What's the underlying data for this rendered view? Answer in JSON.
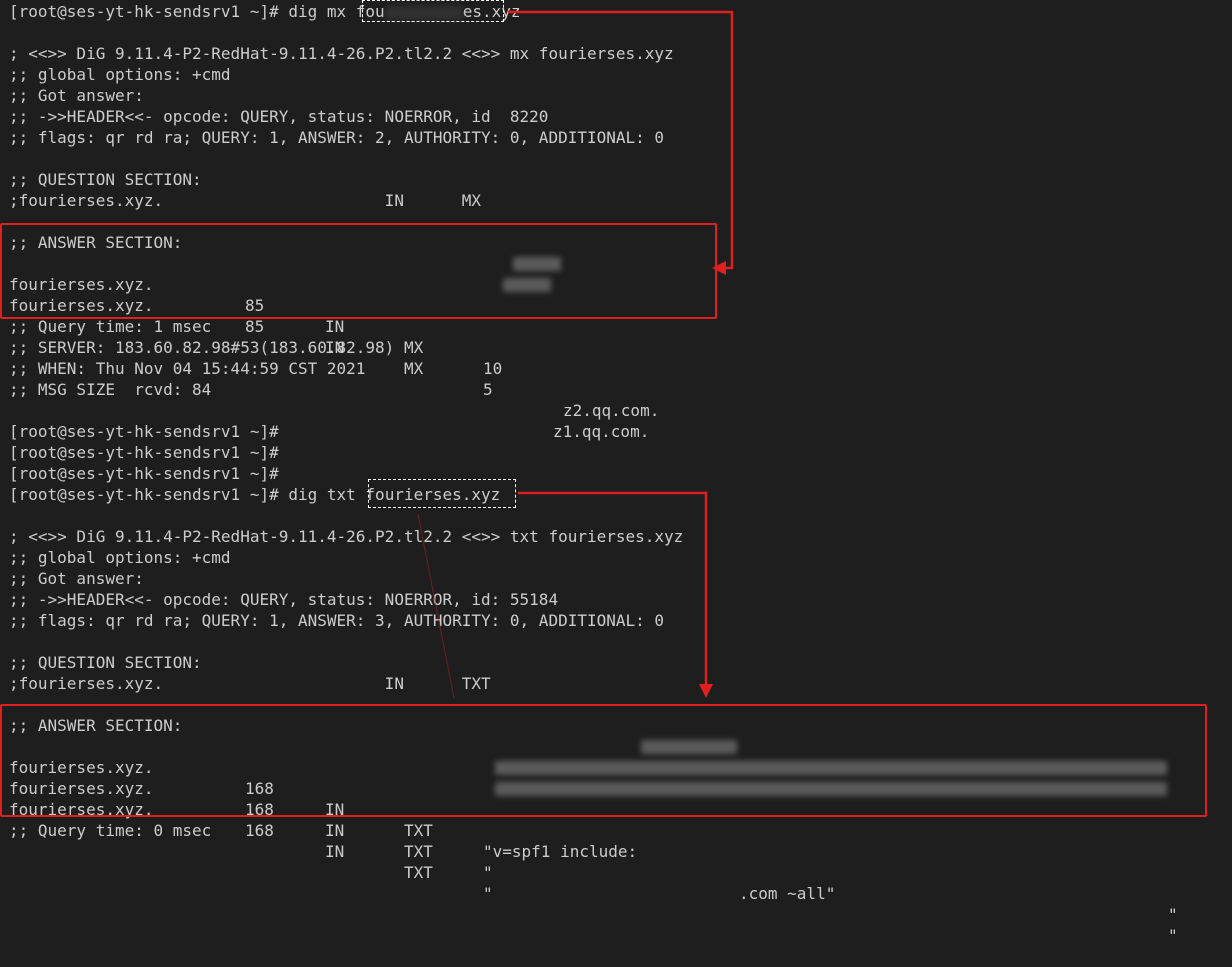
{
  "terminal": {
    "block1": {
      "prompt_cmd": "[root@ses-yt-hk-sendsrv1 ~]# dig mx ",
      "domain_visible_a": "fou",
      "domain_visible_b": "es.xyz",
      "dig_header": "; <<>> DiG 9.11.4-P2-RedHat-9.11.4-26.P2.tl2.2 <<>> mx fourierses.xyz",
      "global_options": ";; global options: +cmd",
      "got_answer": ";; Got answer:",
      "header_line": ";; ->>HEADER<<- opcode: QUERY, status: NOERROR, id  8220",
      "flags_line": ";; flags: qr rd ra; QUERY: 1, ANSWER: 2, AUTHORITY: 0, ADDITIONAL: 0",
      "question_title": ";; QUESTION SECTION:",
      "question_line": ";fourierses.xyz.                       IN      MX",
      "answer_title": ";; ANSWER SECTION:",
      "answers": [
        {
          "name": "fourierses.xyz.",
          "ttl": "85",
          "class": "IN",
          "type": "MX",
          "pref": "10",
          "target_visible": "z2.qq.com."
        },
        {
          "name": "fourierses.xyz.",
          "ttl": "85",
          "class": "IN",
          "type": "MX",
          "pref": "5",
          "target_visible": "z1.qq.com."
        }
      ],
      "query_time": ";; Query time: 1 msec",
      "server": ";; SERVER: 183.60.82.98#53(183.60.82.98)",
      "when": ";; WHEN: Thu Nov 04 15:44:59 CST 2021",
      "msg_size": ";; MSG SIZE  rcvd: 84"
    },
    "prompts": [
      "[root@ses-yt-hk-sendsrv1 ~]#",
      "[root@ses-yt-hk-sendsrv1 ~]#",
      "[root@ses-yt-hk-sendsrv1 ~]#"
    ],
    "block2": {
      "prompt_cmd": "[root@ses-yt-hk-sendsrv1 ~]# dig txt ",
      "domain": "fourierses.xyz",
      "dig_header": "; <<>> DiG 9.11.4-P2-RedHat-9.11.4-26.P2.tl2.2 <<>> txt fourierses.xyz",
      "global_options": ";; global options: +cmd",
      "got_answer": ";; Got answer:",
      "header_line": ";; ->>HEADER<<- opcode: QUERY, status: NOERROR, id: 55184",
      "flags_line": ";; flags: qr rd ra; QUERY: 1, ANSWER: 3, AUTHORITY: 0, ADDITIONAL: 0",
      "question_title": ";; QUESTION SECTION:",
      "question_line": ";fourierses.xyz.                       IN      TXT",
      "answer_title": ";; ANSWER SECTION:",
      "answers": [
        {
          "name": "fourierses.xyz.",
          "ttl": "168",
          "class": "IN",
          "type": "TXT",
          "data_a": "\"v=spf1 include:",
          "data_b": ".com ~all\""
        },
        {
          "name": "fourierses.xyz.",
          "ttl": "168",
          "class": "IN",
          "type": "TXT",
          "data_a": "\"",
          "data_b": "\""
        },
        {
          "name": "fourierses.xyz.",
          "ttl": "168",
          "class": "IN",
          "type": "TXT",
          "data_a": "\"",
          "data_b": "\""
        }
      ],
      "query_time": ";; Query time: 0 msec"
    }
  },
  "colors": {
    "background": "#1e1e1e",
    "text": "#cccccc",
    "annotation_red": "#e02020",
    "dashed_box": "#ffffff"
  }
}
